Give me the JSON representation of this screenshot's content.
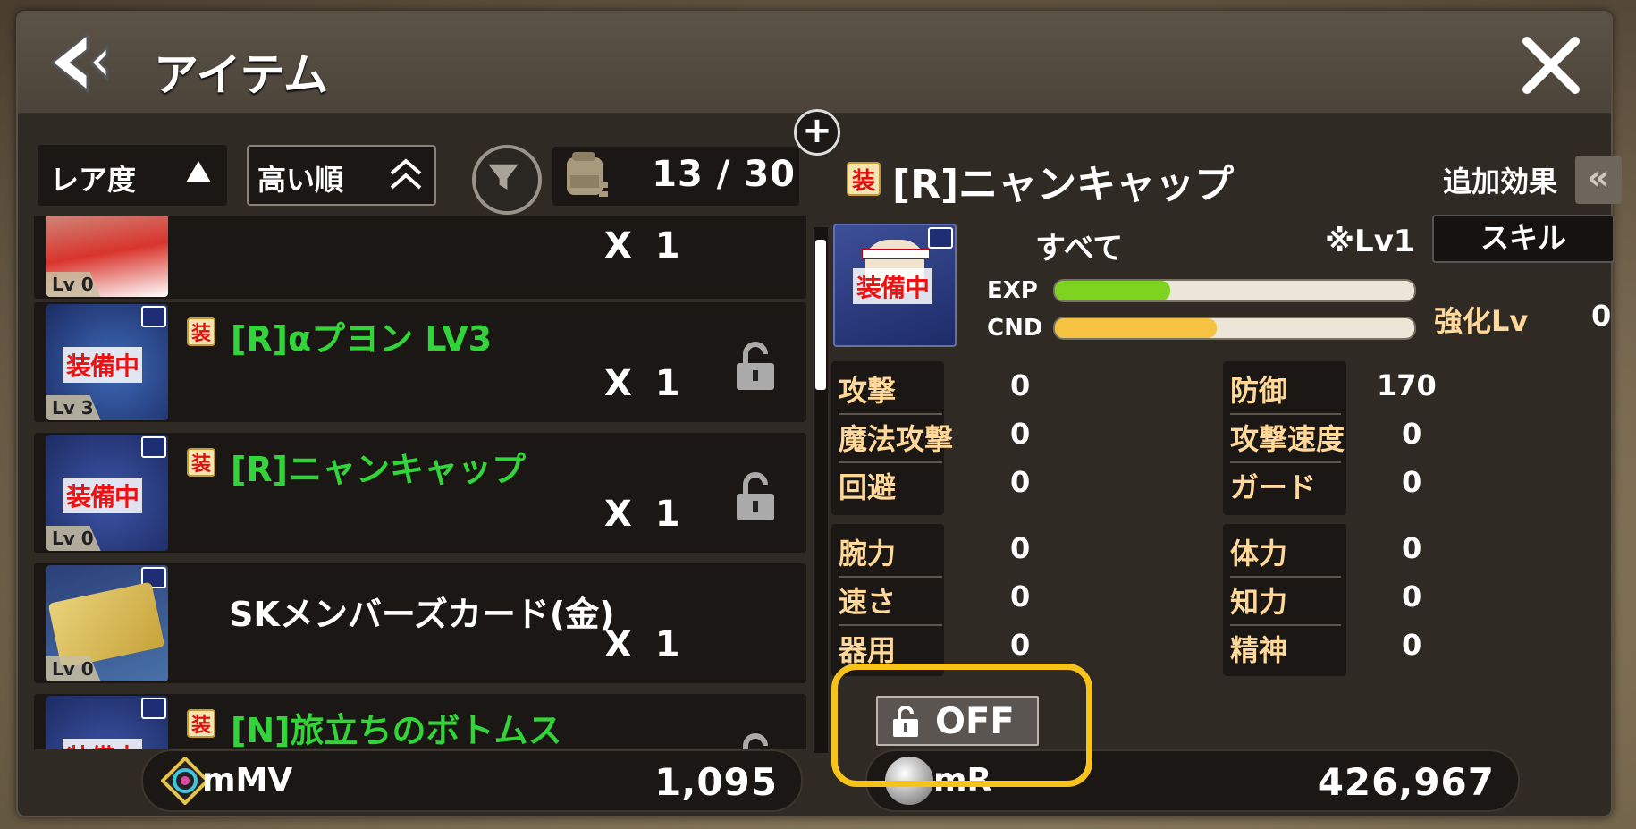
{
  "header": {
    "title": "アイテム"
  },
  "sort": {
    "label": "レア度",
    "order_label": "高い順"
  },
  "bag": {
    "count": "13 / 30"
  },
  "items": [
    {
      "lv": "Lv 0",
      "name": "",
      "qty": "X 1",
      "equipped": false
    },
    {
      "lv": "Lv 3",
      "name": "[R]αプヨン LV3",
      "qty": "X 1",
      "equipped": true,
      "badge": "装備中"
    },
    {
      "lv": "Lv 0",
      "name": "[R]ニャンキャップ",
      "qty": "X 1",
      "equipped": true,
      "badge": "装備中"
    },
    {
      "lv": "Lv 0",
      "name": "SKメンバーズカード(金)",
      "qty": "X 1",
      "equipped": false
    },
    {
      "lv": "",
      "name": "[N]旅立ちのボトムス",
      "qty": "",
      "equipped": true,
      "badge": "装備中"
    }
  ],
  "currency": {
    "mv_label": "mMV",
    "mv_value": "1,095",
    "mr_label": "mR",
    "mr_value": "426,967"
  },
  "detail": {
    "name": "[R]ニャンキャップ",
    "extra_effect": "追加効果",
    "extra_btn": "«",
    "badge": "装備中",
    "category": "すべて",
    "lv_note": "※Lv1",
    "skill": "スキル",
    "exp_label": "EXP",
    "exp_fill": 0.32,
    "cnd_label": "CND",
    "cnd_fill": 0.45,
    "enhance_label": "強化Lv",
    "enhance_value": "0",
    "stats_left": [
      {
        "key": "攻撃",
        "val": "0"
      },
      {
        "key": "魔法攻撃",
        "val": "0"
      },
      {
        "key": "回避",
        "val": "0"
      }
    ],
    "stats_right": [
      {
        "key": "防御",
        "val": "170"
      },
      {
        "key": "攻撃速度",
        "val": "0"
      },
      {
        "key": "ガード",
        "val": "0"
      }
    ],
    "attrs_left": [
      {
        "key": "腕力",
        "val": "0"
      },
      {
        "key": "速さ",
        "val": "0"
      },
      {
        "key": "器用",
        "val": "0"
      }
    ],
    "attrs_right": [
      {
        "key": "体力",
        "val": "0"
      },
      {
        "key": "知力",
        "val": "0"
      },
      {
        "key": "精神",
        "val": "0"
      }
    ],
    "lock_label": "OFF"
  },
  "colors": {
    "highlight": "#f7c21a",
    "rare_name": "#32d43a",
    "exp": "#7ed321",
    "cnd": "#f5c242"
  }
}
